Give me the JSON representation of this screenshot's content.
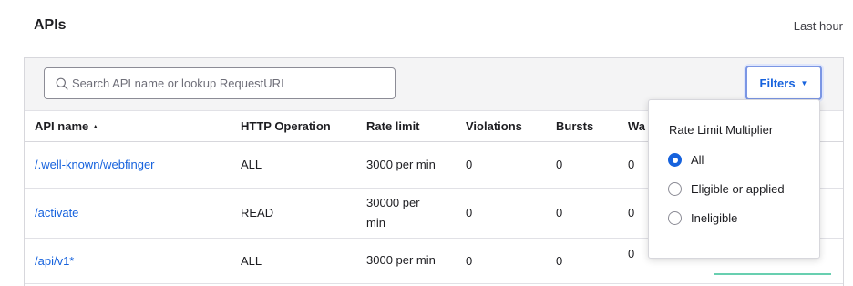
{
  "header": {
    "title": "APIs",
    "time_range": "Last hour"
  },
  "search": {
    "placeholder": "Search API name or lookup RequestURI",
    "value": ""
  },
  "filters": {
    "label": "Filters"
  },
  "table": {
    "columns": [
      "API name",
      "HTTP Operation",
      "Rate limit",
      "Violations",
      "Bursts",
      "Wa"
    ],
    "rows": [
      {
        "api": "/.well-known/webfinger",
        "operation": "ALL",
        "rate_limit": "3000 per min",
        "violations": "0",
        "bursts": "0",
        "warnings": "0"
      },
      {
        "api": "/activate",
        "operation": "READ",
        "rate_limit": "30000 per min",
        "violations": "0",
        "bursts": "0",
        "warnings": "0"
      },
      {
        "api": "/api/v1*",
        "operation": "ALL",
        "rate_limit": "3000 per min",
        "violations": "0",
        "bursts": "0",
        "warnings": "0"
      }
    ]
  },
  "filter_popover": {
    "heading": "Rate Limit Multiplier",
    "options": [
      {
        "label": "All",
        "selected": true
      },
      {
        "label": "Eligible or applied",
        "selected": false
      },
      {
        "label": "Ineligible",
        "selected": false
      }
    ]
  },
  "colors": {
    "accent": "#1662dd",
    "sparkline": "#68cfb0",
    "toolbar_bg": "#f4f4f5"
  }
}
